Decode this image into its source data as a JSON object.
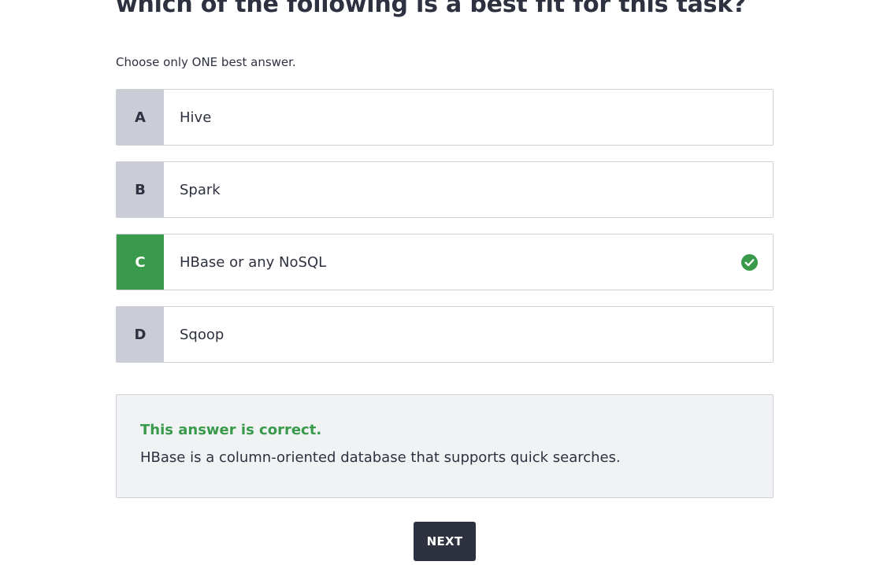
{
  "question": {
    "text": "which of the following is a best fit for this task?",
    "instruction": "Choose only ONE best answer."
  },
  "options": [
    {
      "letter": "A",
      "label": "Hive",
      "state": "default"
    },
    {
      "letter": "B",
      "label": "Spark",
      "state": "default"
    },
    {
      "letter": "C",
      "label": "HBase or any NoSQL",
      "state": "correct",
      "icon": "check-circle-icon"
    },
    {
      "letter": "D",
      "label": "Sqoop",
      "state": "default"
    }
  ],
  "feedback": {
    "title": "This answer is correct.",
    "explanation": "HBase is a column-oriented database that supports quick searches."
  },
  "next_button": {
    "label": "NEXT"
  },
  "colors": {
    "correct": "#3a9a4c",
    "text": "#2e3140",
    "letter_bg": "#cacdd6",
    "feedback_bg": "#f1f2f4",
    "button_bg": "#2e3140"
  }
}
